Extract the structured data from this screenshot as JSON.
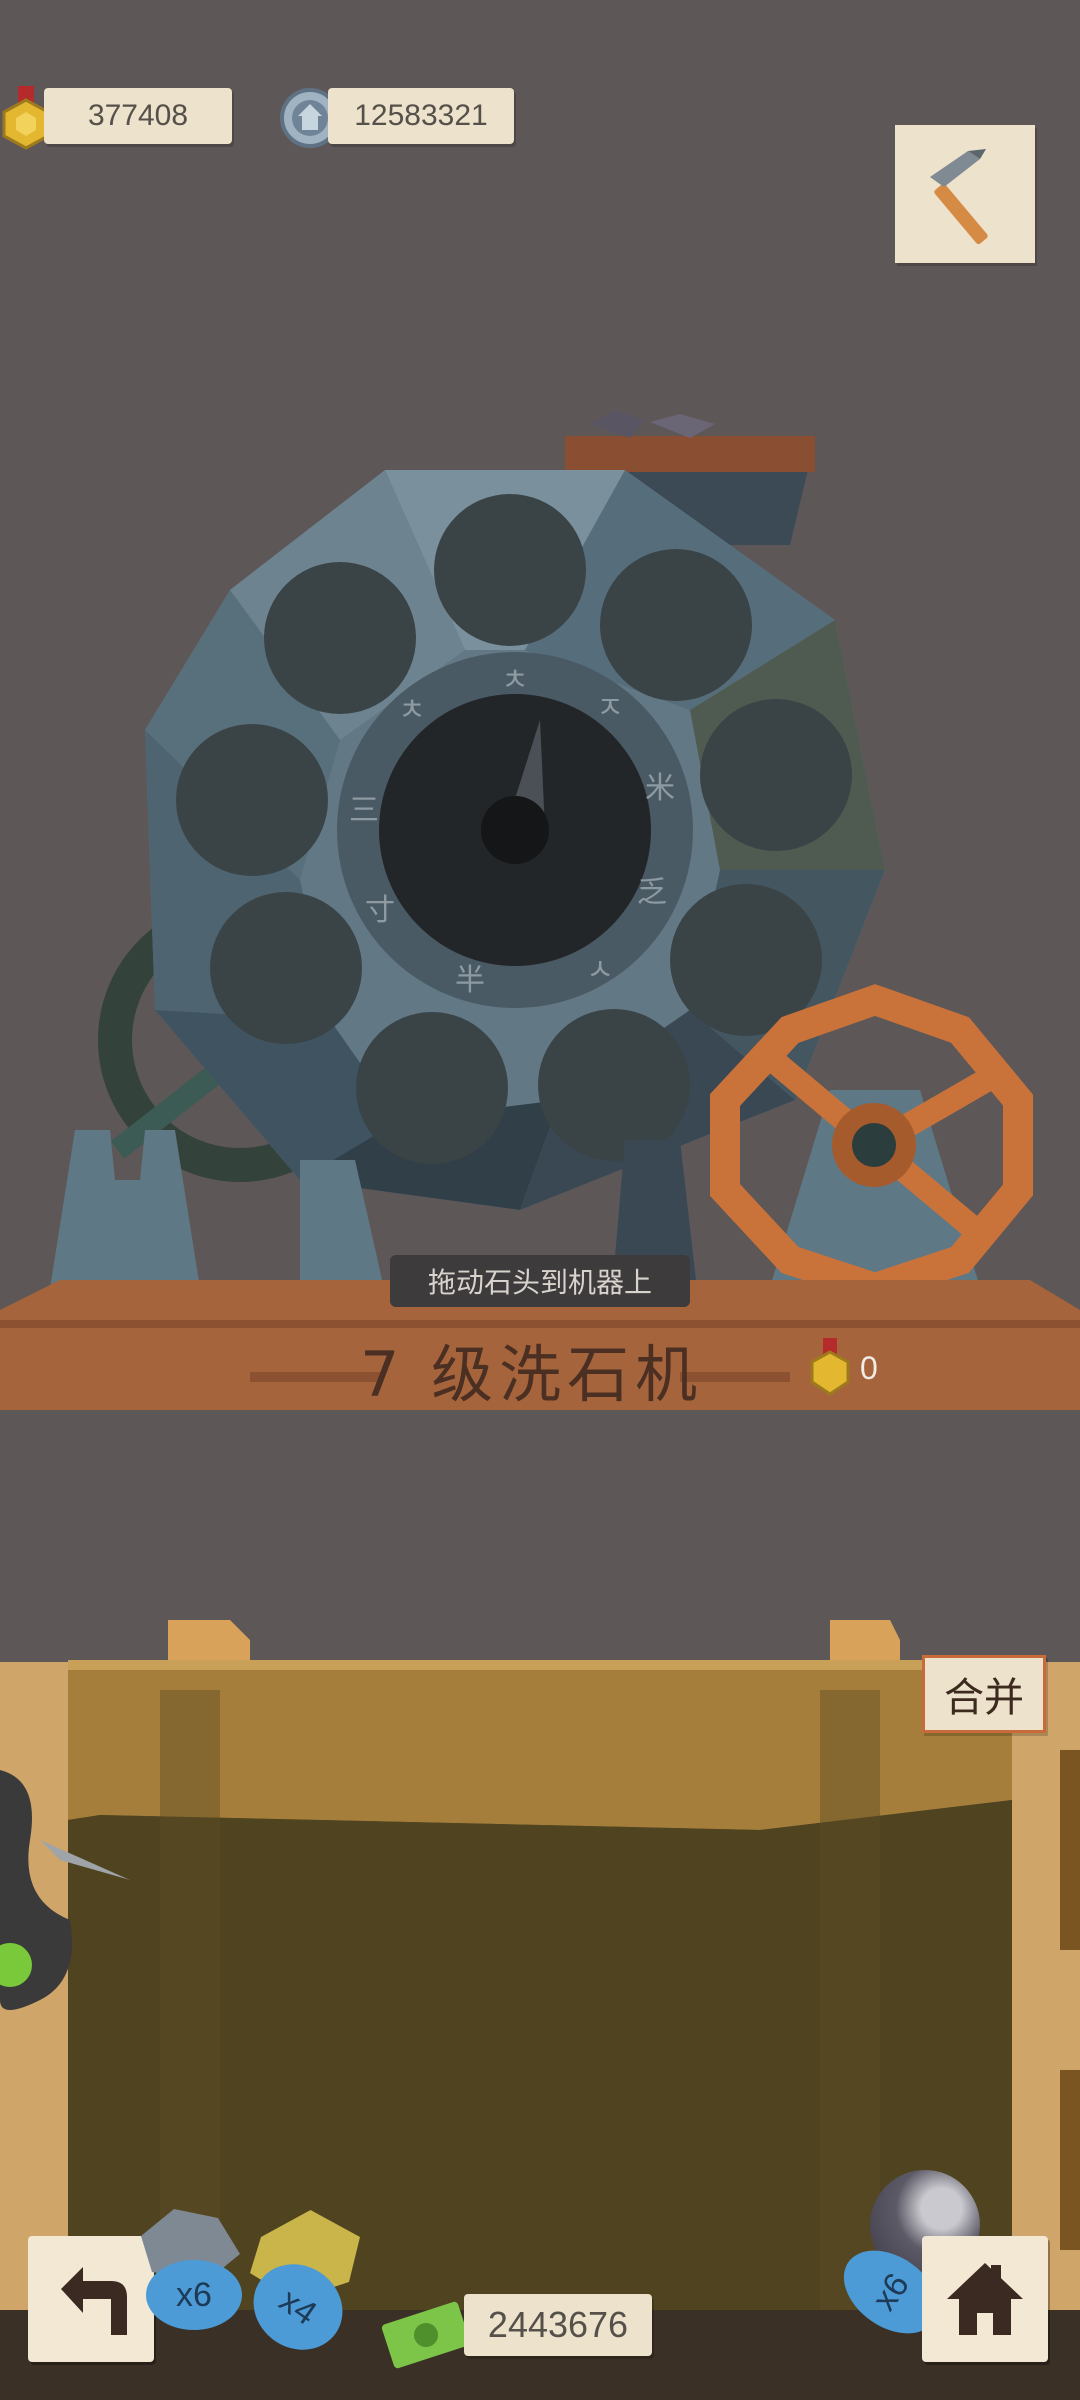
{
  "resources": {
    "medals": "377408",
    "silver": "12583321"
  },
  "machine": {
    "level_title": "7 级洗石机",
    "hint": "拖动石头到机器上",
    "medal_count": "0",
    "dial_runes": [
      "ㅊ",
      "ㅈ",
      "米",
      "乏",
      "ㅅ",
      "半",
      "寸",
      "三",
      "ㅊ"
    ]
  },
  "bin": {
    "merge_label": "合并"
  },
  "bottom": {
    "stack_left_1": "x6",
    "stack_left_2": "x4",
    "stack_right": "x6",
    "cash": "2443676"
  },
  "icons": {
    "tool": "pickaxe-icon",
    "back": "back-arrow-icon",
    "home": "home-icon",
    "cash": "cash-icon",
    "medal": "medal-icon",
    "silver": "silver-coin-icon"
  },
  "colors": {
    "background": "#5e5757",
    "wood": "#a5643c",
    "paper": "#ede2cc",
    "bin": "#6b5a2e"
  }
}
